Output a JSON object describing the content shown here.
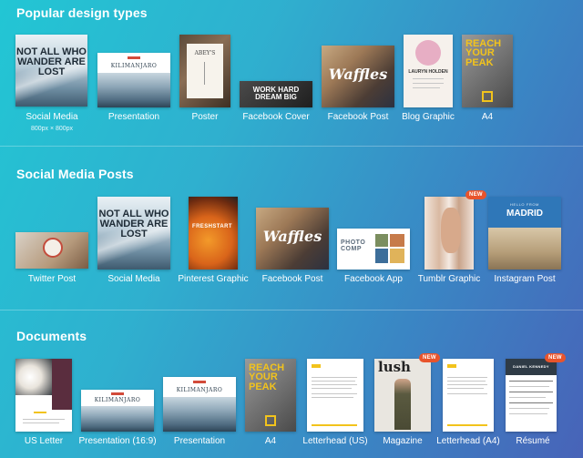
{
  "colors": {
    "background_start": "#22c6d4",
    "background_end": "#4863b8",
    "new_badge": "#e8542c",
    "accent_yellow": "#f2c31c"
  },
  "sections": {
    "popular": {
      "title": "Popular design types",
      "items": [
        {
          "label": "Social Media",
          "sublabel": "800px × 800px",
          "thumb_text": "NOT ALL WHO WANDER ARE LOST"
        },
        {
          "label": "Presentation",
          "thumb_text": "KILIMANJARO"
        },
        {
          "label": "Poster",
          "thumb_text": "ABEY'S"
        },
        {
          "label": "Facebook Cover",
          "thumb_text": "WORK HARD DREAM BIG"
        },
        {
          "label": "Facebook Post",
          "thumb_text": "Waffles"
        },
        {
          "label": "Blog Graphic",
          "thumb_text": "LAURYN HOLDEN"
        },
        {
          "label": "A4",
          "thumb_text": "REACH YOUR PEAK"
        }
      ]
    },
    "social": {
      "title": "Social Media Posts",
      "items": [
        {
          "label": "Twitter Post"
        },
        {
          "label": "Social Media",
          "thumb_text": "NOT ALL WHO WANDER ARE LOST"
        },
        {
          "label": "Pinterest Graphic",
          "thumb_text": "FRESHSTART"
        },
        {
          "label": "Facebook Post",
          "thumb_text": "Waffles"
        },
        {
          "label": "Facebook App",
          "thumb_text": "PHOTO COMP"
        },
        {
          "label": "Tumblr Graphic",
          "badge": "NEW"
        },
        {
          "label": "Instagram Post",
          "thumb_text": "MADRID",
          "thumb_small": "HELLO FROM"
        }
      ]
    },
    "documents": {
      "title": "Documents",
      "items": [
        {
          "label": "US Letter"
        },
        {
          "label": "Presentation (16:9)",
          "thumb_text": "KILIMANJARO"
        },
        {
          "label": "Presentation",
          "thumb_text": "KILIMANJARO"
        },
        {
          "label": "A4",
          "thumb_text": "REACH YOUR PEAK"
        },
        {
          "label": "Letterhead (US)"
        },
        {
          "label": "Magazine",
          "thumb_text": "lush",
          "badge": "NEW"
        },
        {
          "label": "Letterhead (A4)"
        },
        {
          "label": "Résumé",
          "thumb_text": "DANIEL KENNEDY",
          "badge": "NEW"
        }
      ]
    }
  }
}
